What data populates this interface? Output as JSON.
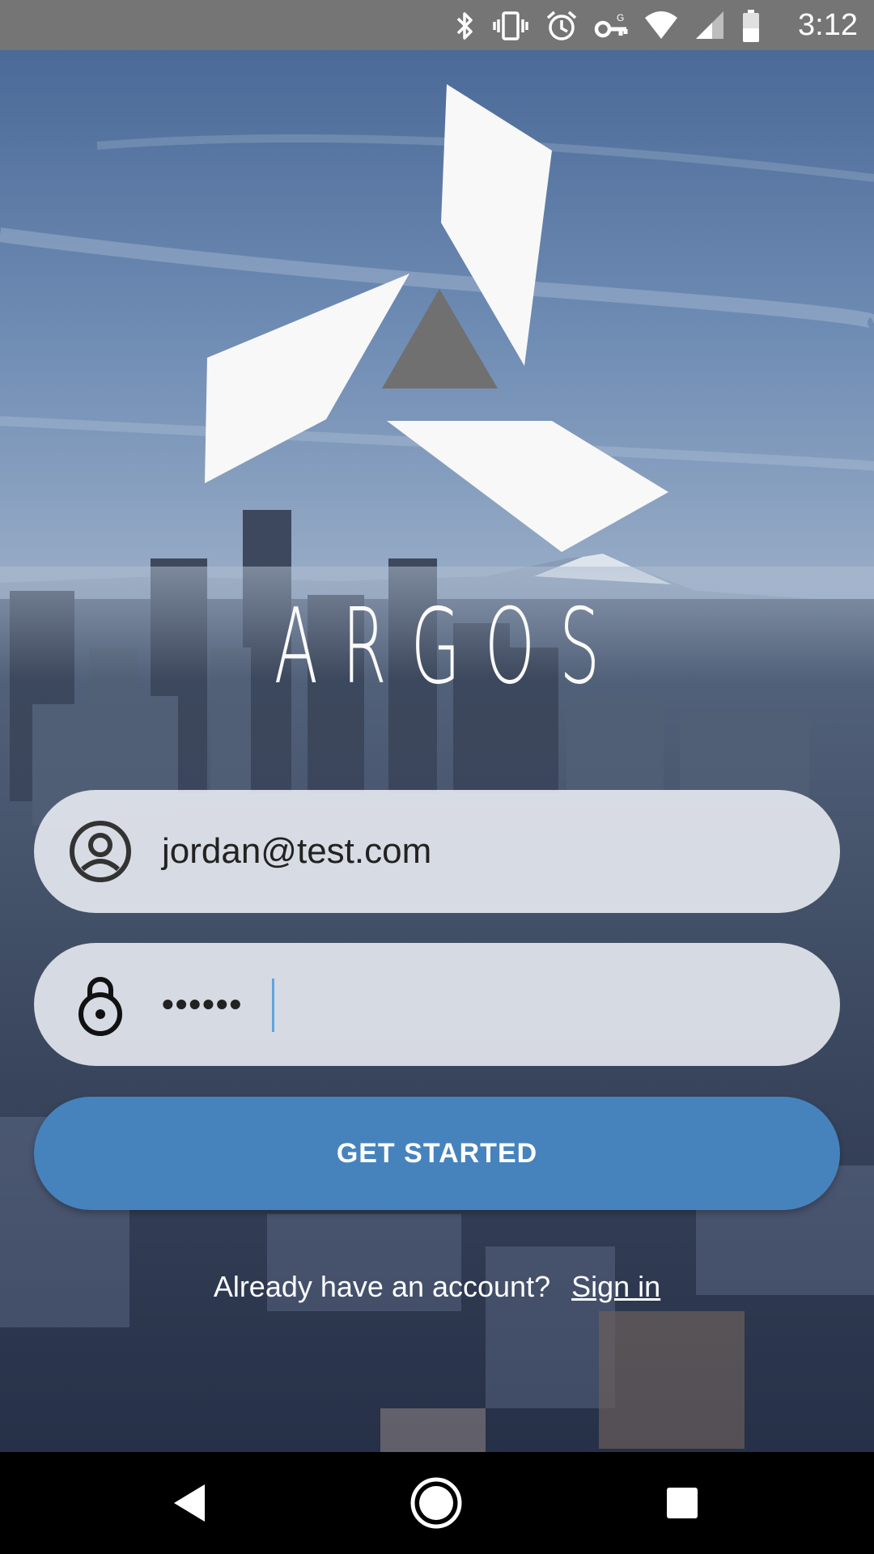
{
  "status_bar": {
    "time": "3:12",
    "icons": [
      "bluetooth-icon",
      "vibrate-icon",
      "alarm-icon",
      "vpn-key-icon",
      "wifi-icon",
      "signal-icon",
      "battery-icon"
    ]
  },
  "brand": {
    "name": "ARGOS",
    "logo_color": "#f8f8f8",
    "logo_center_color": "#707070"
  },
  "form": {
    "email": {
      "icon": "account-circle-icon",
      "value": "jordan@test.com"
    },
    "password": {
      "icon": "lock-icon",
      "value": "••••••"
    }
  },
  "primary_button": {
    "label": "GET STARTED",
    "color": "#4683bd"
  },
  "signin_prompt": {
    "text": "Already have an account?",
    "link_label": "Sign in"
  },
  "nav_bar": {
    "items": [
      "back-icon",
      "home-icon",
      "recents-icon"
    ]
  }
}
